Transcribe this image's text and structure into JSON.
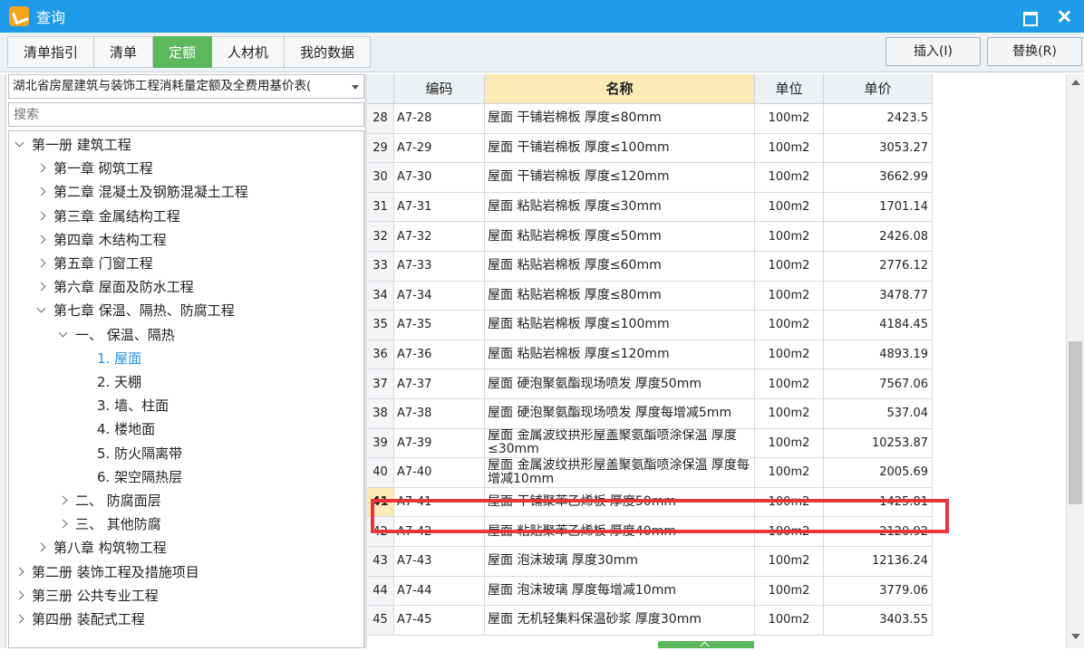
{
  "window": {
    "title": "查询"
  },
  "tabs": [
    "清单指引",
    "清单",
    "定额",
    "人材机",
    "我的数据"
  ],
  "active_tab": "定额",
  "buttons": {
    "insert": "插入(I)",
    "replace": "替换(R)"
  },
  "library_select": {
    "value": "湖北省房屋建筑与装饰工程消耗量定额及全费用基价表("
  },
  "search": {
    "placeholder": "搜索"
  },
  "tree": [
    {
      "label": "第一册  建筑工程",
      "level": 0,
      "state": "expanded"
    },
    {
      "label": "第一章  砌筑工程",
      "level": 1,
      "state": "collapsed"
    },
    {
      "label": "第二章  混凝土及钢筋混凝土工程",
      "level": 1,
      "state": "collapsed"
    },
    {
      "label": "第三章  金属结构工程",
      "level": 1,
      "state": "collapsed"
    },
    {
      "label": "第四章  木结构工程",
      "level": 1,
      "state": "collapsed"
    },
    {
      "label": "第五章  门窗工程",
      "level": 1,
      "state": "collapsed"
    },
    {
      "label": "第六章  屋面及防水工程",
      "level": 1,
      "state": "collapsed"
    },
    {
      "label": "第七章  保温、隔热、防腐工程",
      "level": 1,
      "state": "expanded"
    },
    {
      "label": "一、  保温、隔热",
      "level": 2,
      "state": "expanded"
    },
    {
      "label": "1.  屋面",
      "level": 3,
      "state": "leaf",
      "selected": true
    },
    {
      "label": "2.  天棚",
      "level": 3,
      "state": "leaf"
    },
    {
      "label": "3.  墙、柱面",
      "level": 3,
      "state": "leaf"
    },
    {
      "label": "4.  楼地面",
      "level": 3,
      "state": "leaf"
    },
    {
      "label": "5.  防火隔离带",
      "level": 3,
      "state": "leaf"
    },
    {
      "label": "6.  架空隔热层",
      "level": 3,
      "state": "leaf"
    },
    {
      "label": "二、  防腐面层",
      "level": 2,
      "state": "collapsed"
    },
    {
      "label": "三、  其他防腐",
      "level": 2,
      "state": "collapsed"
    },
    {
      "label": "第八章  构筑物工程",
      "level": 1,
      "state": "collapsed"
    },
    {
      "label": "第二册  装饰工程及措施项目",
      "level": 0,
      "state": "collapsed"
    },
    {
      "label": "第三册  公共专业工程",
      "level": 0,
      "state": "collapsed"
    },
    {
      "label": "第四册  装配式工程",
      "level": 0,
      "state": "collapsed"
    }
  ],
  "table": {
    "headers": {
      "code": "编码",
      "name": "名称",
      "unit": "单位",
      "price": "单价"
    },
    "rows": [
      {
        "idx": "28",
        "code": "A7-28",
        "name": "屋面 干铺岩棉板 厚度≤80mm",
        "unit": "100m2",
        "price": "2423.5"
      },
      {
        "idx": "29",
        "code": "A7-29",
        "name": "屋面 干铺岩棉板 厚度≤100mm",
        "unit": "100m2",
        "price": "3053.27"
      },
      {
        "idx": "30",
        "code": "A7-30",
        "name": "屋面 干铺岩棉板 厚度≤120mm",
        "unit": "100m2",
        "price": "3662.99"
      },
      {
        "idx": "31",
        "code": "A7-31",
        "name": "屋面 粘贴岩棉板 厚度≤30mm",
        "unit": "100m2",
        "price": "1701.14"
      },
      {
        "idx": "32",
        "code": "A7-32",
        "name": "屋面 粘贴岩棉板 厚度≤50mm",
        "unit": "100m2",
        "price": "2426.08"
      },
      {
        "idx": "33",
        "code": "A7-33",
        "name": "屋面 粘贴岩棉板 厚度≤60mm",
        "unit": "100m2",
        "price": "2776.12"
      },
      {
        "idx": "34",
        "code": "A7-34",
        "name": "屋面 粘贴岩棉板 厚度≤80mm",
        "unit": "100m2",
        "price": "3478.77"
      },
      {
        "idx": "35",
        "code": "A7-35",
        "name": "屋面 粘贴岩棉板 厚度≤100mm",
        "unit": "100m2",
        "price": "4184.45"
      },
      {
        "idx": "36",
        "code": "A7-36",
        "name": "屋面 粘贴岩棉板 厚度≤120mm",
        "unit": "100m2",
        "price": "4893.19"
      },
      {
        "idx": "37",
        "code": "A7-37",
        "name": "屋面 硬泡聚氨酯现场喷发 厚度50mm",
        "unit": "100m2",
        "price": "7567.06"
      },
      {
        "idx": "38",
        "code": "A7-38",
        "name": "屋面 硬泡聚氨酯现场喷发 厚度每增减5mm",
        "unit": "100m2",
        "price": "537.04"
      },
      {
        "idx": "39",
        "code": "A7-39",
        "name": "屋面 金属波纹拱形屋盖聚氨酯喷涂保温 厚度≤30mm",
        "unit": "100m2",
        "price": "10253.87"
      },
      {
        "idx": "40",
        "code": "A7-40",
        "name": "屋面 金属波纹拱形屋盖聚氨酯喷涂保温 厚度每增减10mm",
        "unit": "100m2",
        "price": "2005.69"
      },
      {
        "idx": "41",
        "code": "A7-41",
        "name": "屋面 干铺聚苯乙烯板 厚度50mm",
        "unit": "100m2",
        "price": "1425.81",
        "current": true
      },
      {
        "idx": "42",
        "code": "A7-42",
        "name": "屋面 粘贴聚苯乙烯板 厚度40mm",
        "unit": "100m2",
        "price": "2120.92"
      },
      {
        "idx": "43",
        "code": "A7-43",
        "name": "屋面 泡沫玻璃 厚度30mm",
        "unit": "100m2",
        "price": "12136.24"
      },
      {
        "idx": "44",
        "code": "A7-44",
        "name": "屋面 泡沫玻璃 厚度每增减10mm",
        "unit": "100m2",
        "price": "3779.06"
      },
      {
        "idx": "45",
        "code": "A7-45",
        "name": "屋面 无机轻集料保温砂浆 厚度30mm",
        "unit": "100m2",
        "price": "3403.55"
      }
    ]
  },
  "colors": {
    "titlebar": "#1e9be8",
    "active_tab": "#5cb85c",
    "highlight": "#e8343b",
    "sorted_header": "#fbeab6"
  }
}
